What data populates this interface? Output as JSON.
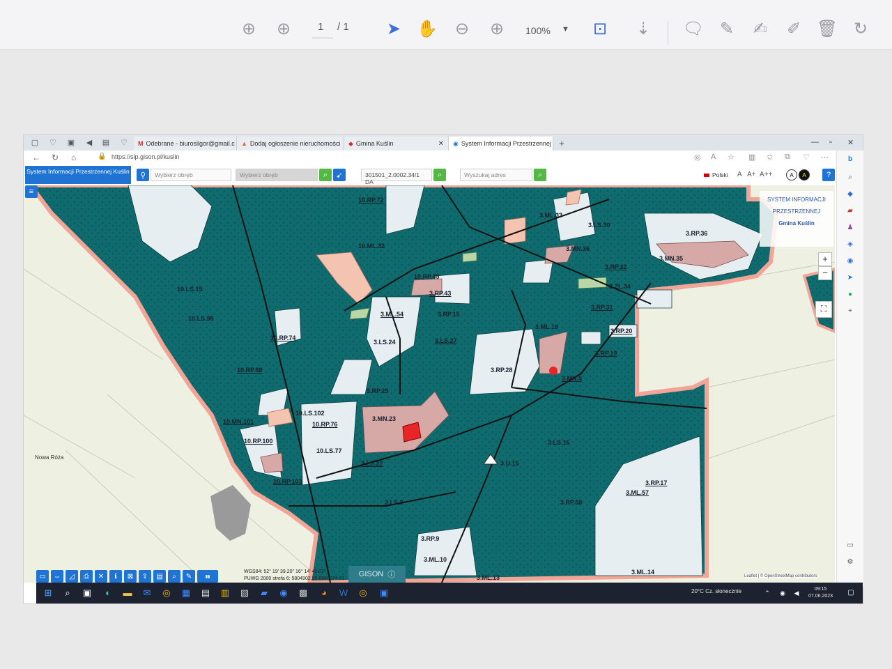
{
  "pdf_viewer": {
    "page_current": "1",
    "page_total": "/ 1",
    "zoom": "100%"
  },
  "browser": {
    "tabs": [
      {
        "label": "Odebrane - biurosilgor@gmail.c"
      },
      {
        "label": "Dodaj ogłoszenie nieruchomości"
      },
      {
        "label": "Gmina Kuślin"
      },
      {
        "label": "System Informacji Przestrzennej"
      }
    ],
    "url": "https://sip.gison.pl/kuslin"
  },
  "app": {
    "brand": "System Informacji Przestrzennej Kuślin",
    "select_area_placeholder": "Wybierz obręb",
    "select_plot_placeholder": "Wybierz obręb",
    "plot_id": "301501_2.0002.34/1 DA",
    "address_placeholder": "Wyszukaj adres",
    "language": "Polski",
    "font_sizes": [
      "A",
      "A+",
      "A++"
    ]
  },
  "map": {
    "panel_title_1": "SYSTEM INFORMACJI",
    "panel_title_2": "PRZESTRZENNEJ",
    "panel_subtitle": "Gmina Kuślin",
    "labels": [
      "10.RP.72",
      "3.ML.33",
      "3.LS.30",
      "3.RP.36",
      "10.ML.32",
      "3.MN.35",
      "3.RP.32",
      "3.RP.43",
      "10.LS.98",
      "3.ML.54",
      "3.LS.24",
      "3.LS.27",
      "3.RP.20",
      "3.ML.19",
      "10.RP.74",
      "3.RP.19",
      "10.RP.88",
      "3.RP.28",
      "3.MN.5",
      "3.RP.25",
      "10.MN.101",
      "10.LS.102",
      "3.MN.23",
      "10.RP.76",
      "10.RP.100",
      "3.LS.16",
      "10.LS.77",
      "3.LS.22",
      "3.U.15",
      "10.RP.103",
      "3.RP.17",
      "3.ML.57",
      "3.LS.8",
      "3.RP.58",
      "3.RP.9",
      "3.ML.10",
      "3.ML.13",
      "3.ML.14",
      "10.RP.45",
      "10.LS.15",
      "3.RP.31",
      "3.MN.36",
      "3.RP.15",
      "3.ZL.34"
    ],
    "place_name": "Nowa Róża",
    "coords_line_1": "WGS84: 52° 19' 39.20\" 16° 14' 40.02\"",
    "coords_line_2": "PUWG 2000 strefa 6: 5804902.95 6800074.91",
    "gison": "GISON",
    "attribution": "Leaflet | © OpenStreetMap contributors"
  },
  "taskbar": {
    "weather": "20°C Cz. słonecznie",
    "time": "09:15",
    "date": "07.06.2023"
  },
  "colors": {
    "teal": "#0f6b6e",
    "salmon": "#f2a597",
    "pale": "#e6eef2",
    "pink": "#d7a9a6",
    "mint": "#b9d6a8"
  }
}
